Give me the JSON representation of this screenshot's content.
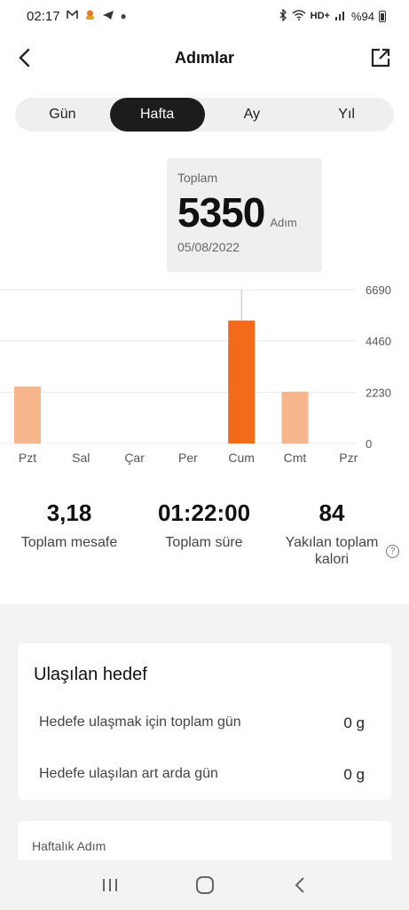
{
  "status_bar": {
    "time": "02:17",
    "notification_icons": [
      "mail-icon",
      "app-icon",
      "telegram-icon",
      "dot-icon"
    ],
    "network": "HD+",
    "battery": "%94"
  },
  "header": {
    "title": "Adımlar"
  },
  "period_tabs": [
    {
      "label": "Gün",
      "active": false
    },
    {
      "label": "Hafta",
      "active": true
    },
    {
      "label": "Ay",
      "active": false
    },
    {
      "label": "Yıl",
      "active": false
    }
  ],
  "tooltip": {
    "label": "Toplam",
    "value": "5350",
    "unit": "Adım",
    "date": "05/08/2022"
  },
  "chart_data": {
    "type": "bar",
    "categories": [
      "Pzt",
      "Sal",
      "Çar",
      "Per",
      "Cum",
      "Cmt",
      "Pzr"
    ],
    "values": [
      2480,
      0,
      0,
      0,
      5350,
      2250,
      0
    ],
    "ylim": [
      0,
      6690
    ],
    "yticks": [
      "0",
      "2230",
      "4460",
      "6690"
    ],
    "selected_index": 4,
    "colors": {
      "bar": "#f7b58c",
      "selected": "#f26a1b"
    }
  },
  "stats": [
    {
      "value": "3,18",
      "label": "Toplam mesafe"
    },
    {
      "value": "01:22:00",
      "label": "Toplam süre"
    },
    {
      "value": "84",
      "label": "Yakılan toplam kalori"
    }
  ],
  "goal": {
    "title": "Ulaşılan hedef",
    "rows": [
      {
        "label": "Hedefe ulaşmak için toplam gün",
        "value": "0 g"
      },
      {
        "label": "Hedefe ulaşılan art arda gün",
        "value": "0 g"
      }
    ]
  },
  "weekly": {
    "title": "Haftalık Adım"
  }
}
